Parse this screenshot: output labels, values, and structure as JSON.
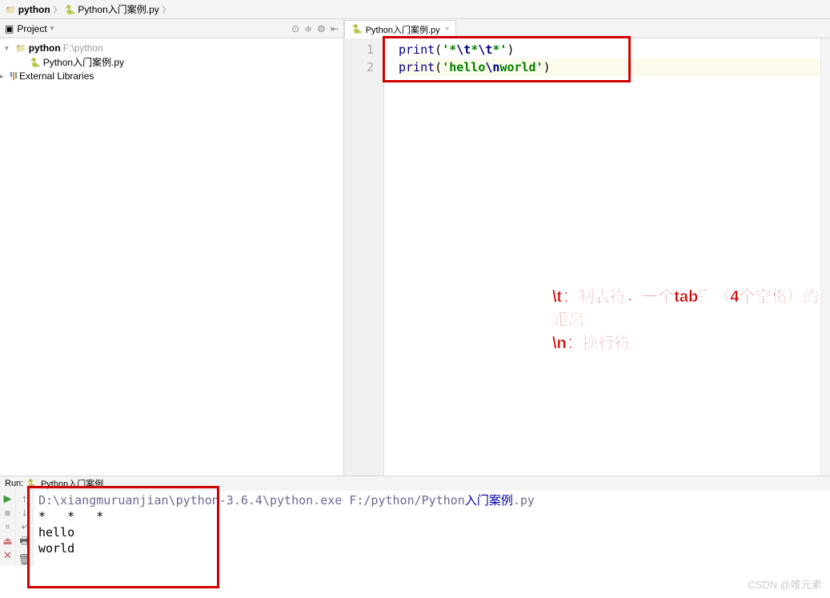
{
  "breadcrumb": {
    "item1": "python",
    "item2": "Python入门案例.py"
  },
  "project": {
    "title": "Project",
    "tree": {
      "root_name": "python",
      "root_hint": "F:\\python",
      "file1": "Python入门案例.py",
      "libs": "External Libraries"
    }
  },
  "editor": {
    "tab_name": "Python入门案例.py",
    "line1_num": "1",
    "line2_num": "2",
    "code": {
      "l1_fn": "print",
      "l1_p1": "(",
      "l1_s1": "'*",
      "l1_e1": "\\t",
      "l1_s2": "*",
      "l1_e2": "\\t",
      "l1_s3": "*'",
      "l1_p2": ")",
      "l2_fn": "print",
      "l2_p1": "(",
      "l2_s1": "'hello",
      "l2_e1": "\\n",
      "l2_s2": "world'",
      "l2_p2": ")"
    }
  },
  "annotation": {
    "line1": "\\t：制表符，一个tab键（4个空格）的距离",
    "line2": "\\n：换行符"
  },
  "run": {
    "label": "Run:",
    "config": "Python入门案例",
    "cmd_pre": "D:\\xiangmuruanjian\\python-3.6.4\\python.exe F:/python/Python",
    "cmd_cn": "入门案例",
    "cmd_post": ".py",
    "out1": "*   *   *",
    "out2": "hello",
    "out3": "world"
  },
  "watermark": "CSDN @唯元素"
}
